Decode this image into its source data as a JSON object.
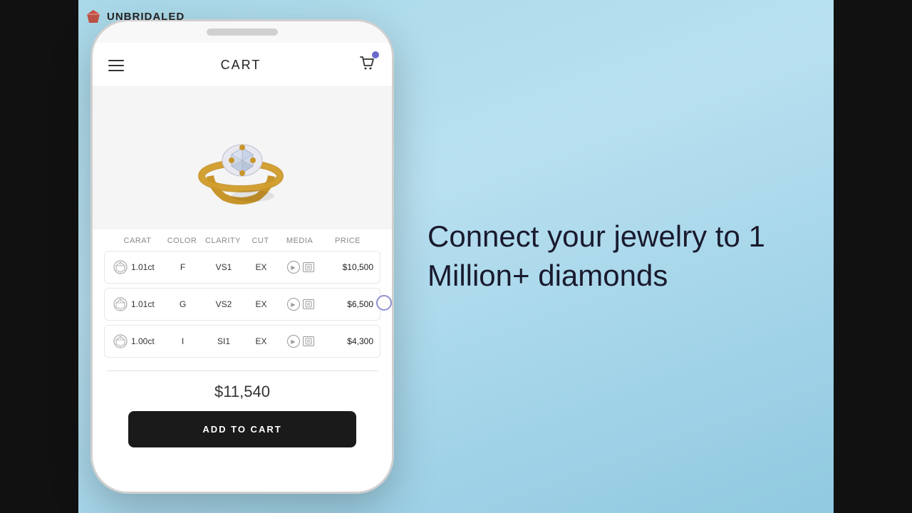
{
  "logo": {
    "brand_name": "UNBRIDALED"
  },
  "header": {
    "title": "CART"
  },
  "diamonds": {
    "columns": [
      "CARAT",
      "COLOR",
      "CLARITY",
      "CUT",
      "MEDIA",
      "PRICE"
    ],
    "rows": [
      {
        "carat": "1.01ct",
        "color": "F",
        "clarity": "VS1",
        "cut": "EX",
        "price": "$10,500"
      },
      {
        "carat": "1.01ct",
        "color": "G",
        "clarity": "VS2",
        "cut": "EX",
        "price": "$6,500"
      },
      {
        "carat": "1.00ct",
        "color": "I",
        "clarity": "SI1",
        "cut": "EX",
        "price": "$4,300"
      }
    ]
  },
  "total": "$11,540",
  "add_to_cart_label": "ADD TO CART",
  "tagline": "Connect your jewelry to 1 Million+ diamonds"
}
